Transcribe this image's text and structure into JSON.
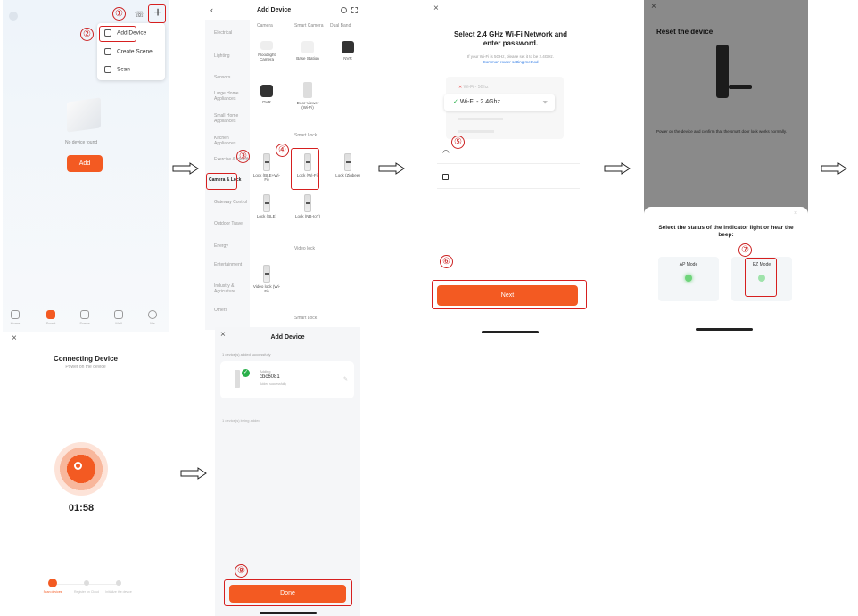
{
  "steps": [
    "①",
    "②",
    "③",
    "④",
    "⑤",
    "⑥",
    "⑦",
    "⑧"
  ],
  "screen1": {
    "menu_items": [
      "Add Device",
      "Create Scene",
      "Scan"
    ],
    "empty_text": "No device found",
    "add_button": "Add",
    "tabs": [
      "Home",
      "Smart",
      "Scene",
      "Mall",
      "Me"
    ]
  },
  "screen2": {
    "title": "Add Device",
    "top_labels": [
      "Camera",
      "Smart Camera",
      "Dual Band"
    ],
    "categories": [
      "Electrical",
      "Lighting",
      "Sensors",
      "Large Home Appliances",
      "Small Home Appliances",
      "Kitchen Appliances",
      "Exercise & Health",
      "Camera & Lock",
      "Gateway Control",
      "Outdoor Travel",
      "Energy",
      "Entertainment",
      "Industry & Agriculture",
      "Others"
    ],
    "products": [
      {
        "label": "Floodlight Camera"
      },
      {
        "label": "Base Station"
      },
      {
        "label": "NVR"
      },
      {
        "label": "DVR"
      },
      {
        "label": "Door Viewer (Wi-Fi)"
      },
      {
        "label": "Lock (BLE+Wi-Fi)"
      },
      {
        "label": "Lock (Wi-Fi)"
      },
      {
        "label": "Lock (Zigbee)"
      },
      {
        "label": "Lock (BLE)"
      },
      {
        "label": "Lock (NB-IoT)"
      },
      {
        "label": "Video lock (Wi-Fi)"
      }
    ],
    "section_labels": [
      "Smart Lock",
      "Video lock",
      "Smart Lock"
    ]
  },
  "screen3": {
    "title": "Select 2.4 GHz Wi-Fi Network and enter password.",
    "hint": "If your Wi-Fi is 5GHz, please set it to be 2.4GHz.",
    "hint_link": "Common router setting method",
    "wifi_5g": "Wi-Fi - 5Ghz",
    "wifi_24": "Wi-Fi - 2.4Ghz",
    "next_button": "Next"
  },
  "screen4": {
    "title": "Reset the device",
    "instruction": "Power on the device and confirm that the smart door lock works normally.",
    "sheet_title": "Select the status of the indicator light or hear the beep:",
    "ap_mode": "AP Mode",
    "ez_mode": "EZ Mode"
  },
  "screen5": {
    "title": "Connecting Device",
    "subtitle": "Power on the device",
    "timer": "01:58",
    "steps": [
      "Scan devices",
      "Register on Cloud",
      "Initialize the device"
    ]
  },
  "screen6": {
    "title": "Add Device",
    "summary": "1 device(s) added successfully",
    "device_status": "Adding",
    "device_name": "cbc6081",
    "device_sub": "Added successfully",
    "auto_text": "1 device(s) being added",
    "done_button": "Done"
  },
  "colors": {
    "accent": "#f35a22",
    "highlight": "#d61f1f",
    "wifi_check": "#2ab04a",
    "link": "#2f7be5"
  }
}
